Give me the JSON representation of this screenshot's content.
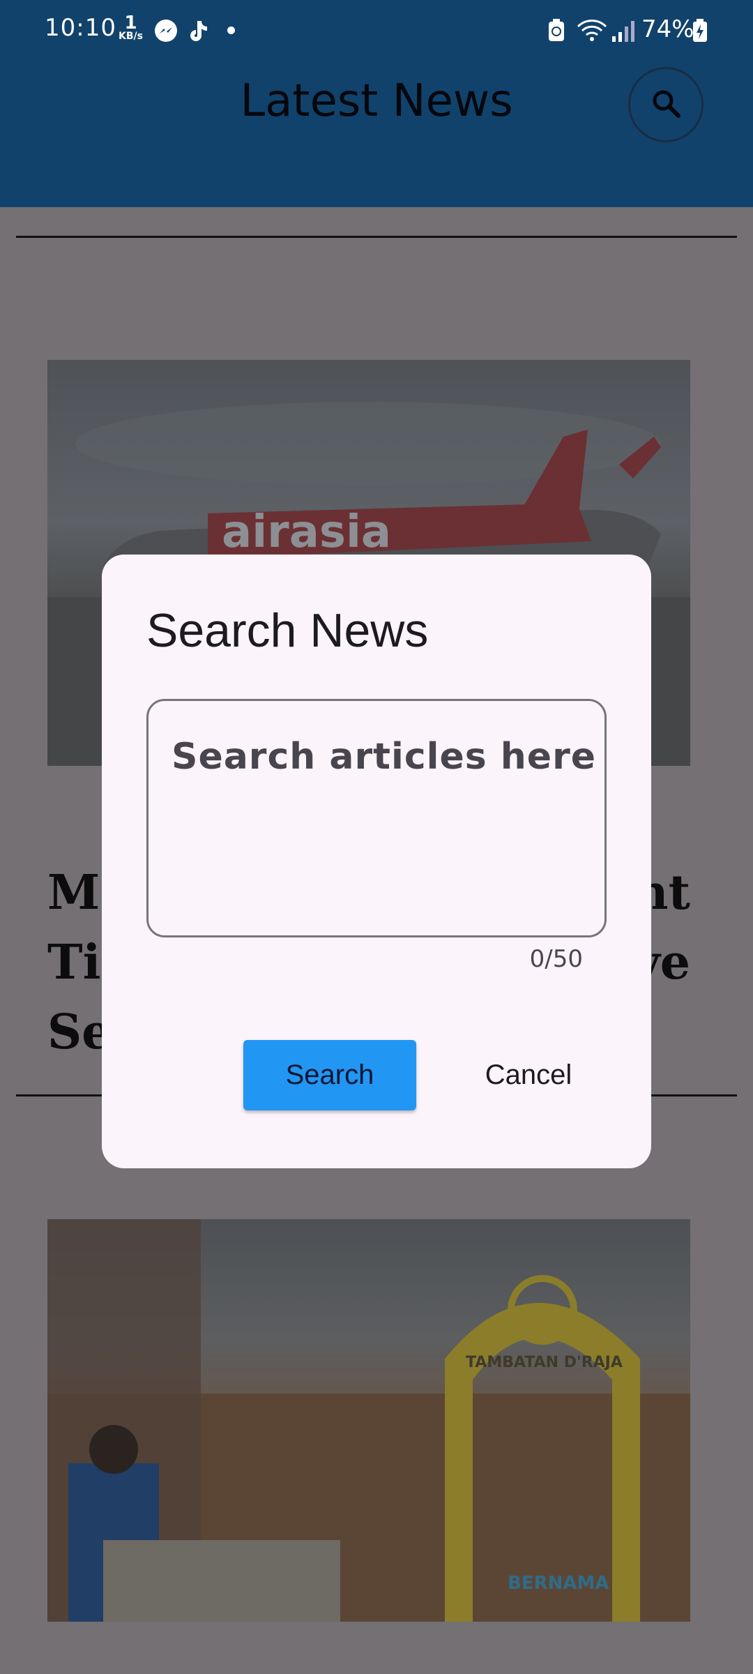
{
  "status_bar": {
    "time": "10:10",
    "net_speed_value": "1",
    "net_speed_unit": "KB/s",
    "battery_percent": "74%"
  },
  "app_bar": {
    "title": "Latest News",
    "search_icon": "search-icon"
  },
  "article_1": {
    "headline_left": "M",
    "headline_left_2": "Ti",
    "headline_left_3": "Se",
    "headline_right": "nt",
    "headline_right_2": "ve",
    "image_text": "airasia"
  },
  "article_2": {
    "image_sign": "TAMBATAN D'RAJA",
    "image_watermark": "BERNAMA"
  },
  "dialog": {
    "title": "Search News",
    "input_placeholder": "Search articles here",
    "input_value": "",
    "counter": "0/50",
    "search_label": "Search",
    "cancel_label": "Cancel"
  },
  "colors": {
    "app_bar": "#11426b",
    "primary_button": "#2196f3",
    "dialog_bg": "#fcf4fb",
    "scrim_bg": "#747074"
  }
}
